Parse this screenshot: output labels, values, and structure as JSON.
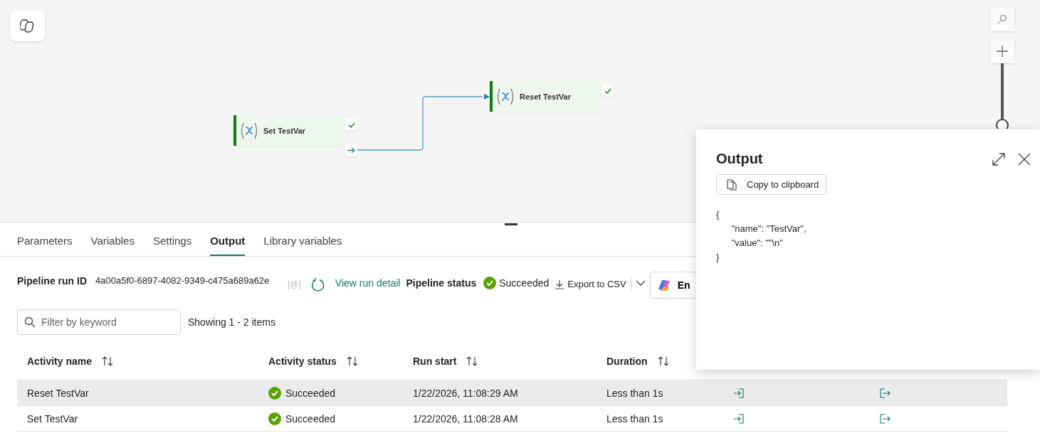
{
  "canvas": {
    "nodes": [
      {
        "name": "Set TestVar",
        "succeeded": true
      },
      {
        "name": "Reset TestVar",
        "succeeded": true
      }
    ]
  },
  "tabs": [
    {
      "label": "Parameters",
      "selected": false
    },
    {
      "label": "Variables",
      "selected": false
    },
    {
      "label": "Settings",
      "selected": false
    },
    {
      "label": "Output",
      "selected": true
    },
    {
      "label": "Library variables",
      "selected": false
    }
  ],
  "run": {
    "id_label": "Pipeline run ID",
    "id": "4a00a5f0-6897-4082-9349-c475a689a62e",
    "copy_glyph": "[@]",
    "view_link": "View run detail",
    "status_label": "Pipeline status",
    "status": "Succeeded",
    "export": "Export to CSV",
    "copilot": "En"
  },
  "filter": {
    "placeholder": "Filter by keyword",
    "count": "Showing 1 - 2 items"
  },
  "table": {
    "columns": [
      "Activity name",
      "Activity status",
      "Run start",
      "Duration"
    ],
    "rows": [
      {
        "name": "Reset TestVar",
        "status": "Succeeded",
        "run_start": "1/22/2026, 11:08:29 AM",
        "duration": "Less than 1s",
        "selected": true
      },
      {
        "name": "Set TestVar",
        "status": "Succeeded",
        "run_start": "1/22/2026, 11:08:28 AM",
        "duration": "Less than 1s",
        "selected": false
      }
    ]
  },
  "output_panel": {
    "title": "Output",
    "copy_button": "Copy to clipboard",
    "code": "{\n      \"name\": \"TestVar\",\n      \"value\": \"\"\\n\"\n}"
  }
}
